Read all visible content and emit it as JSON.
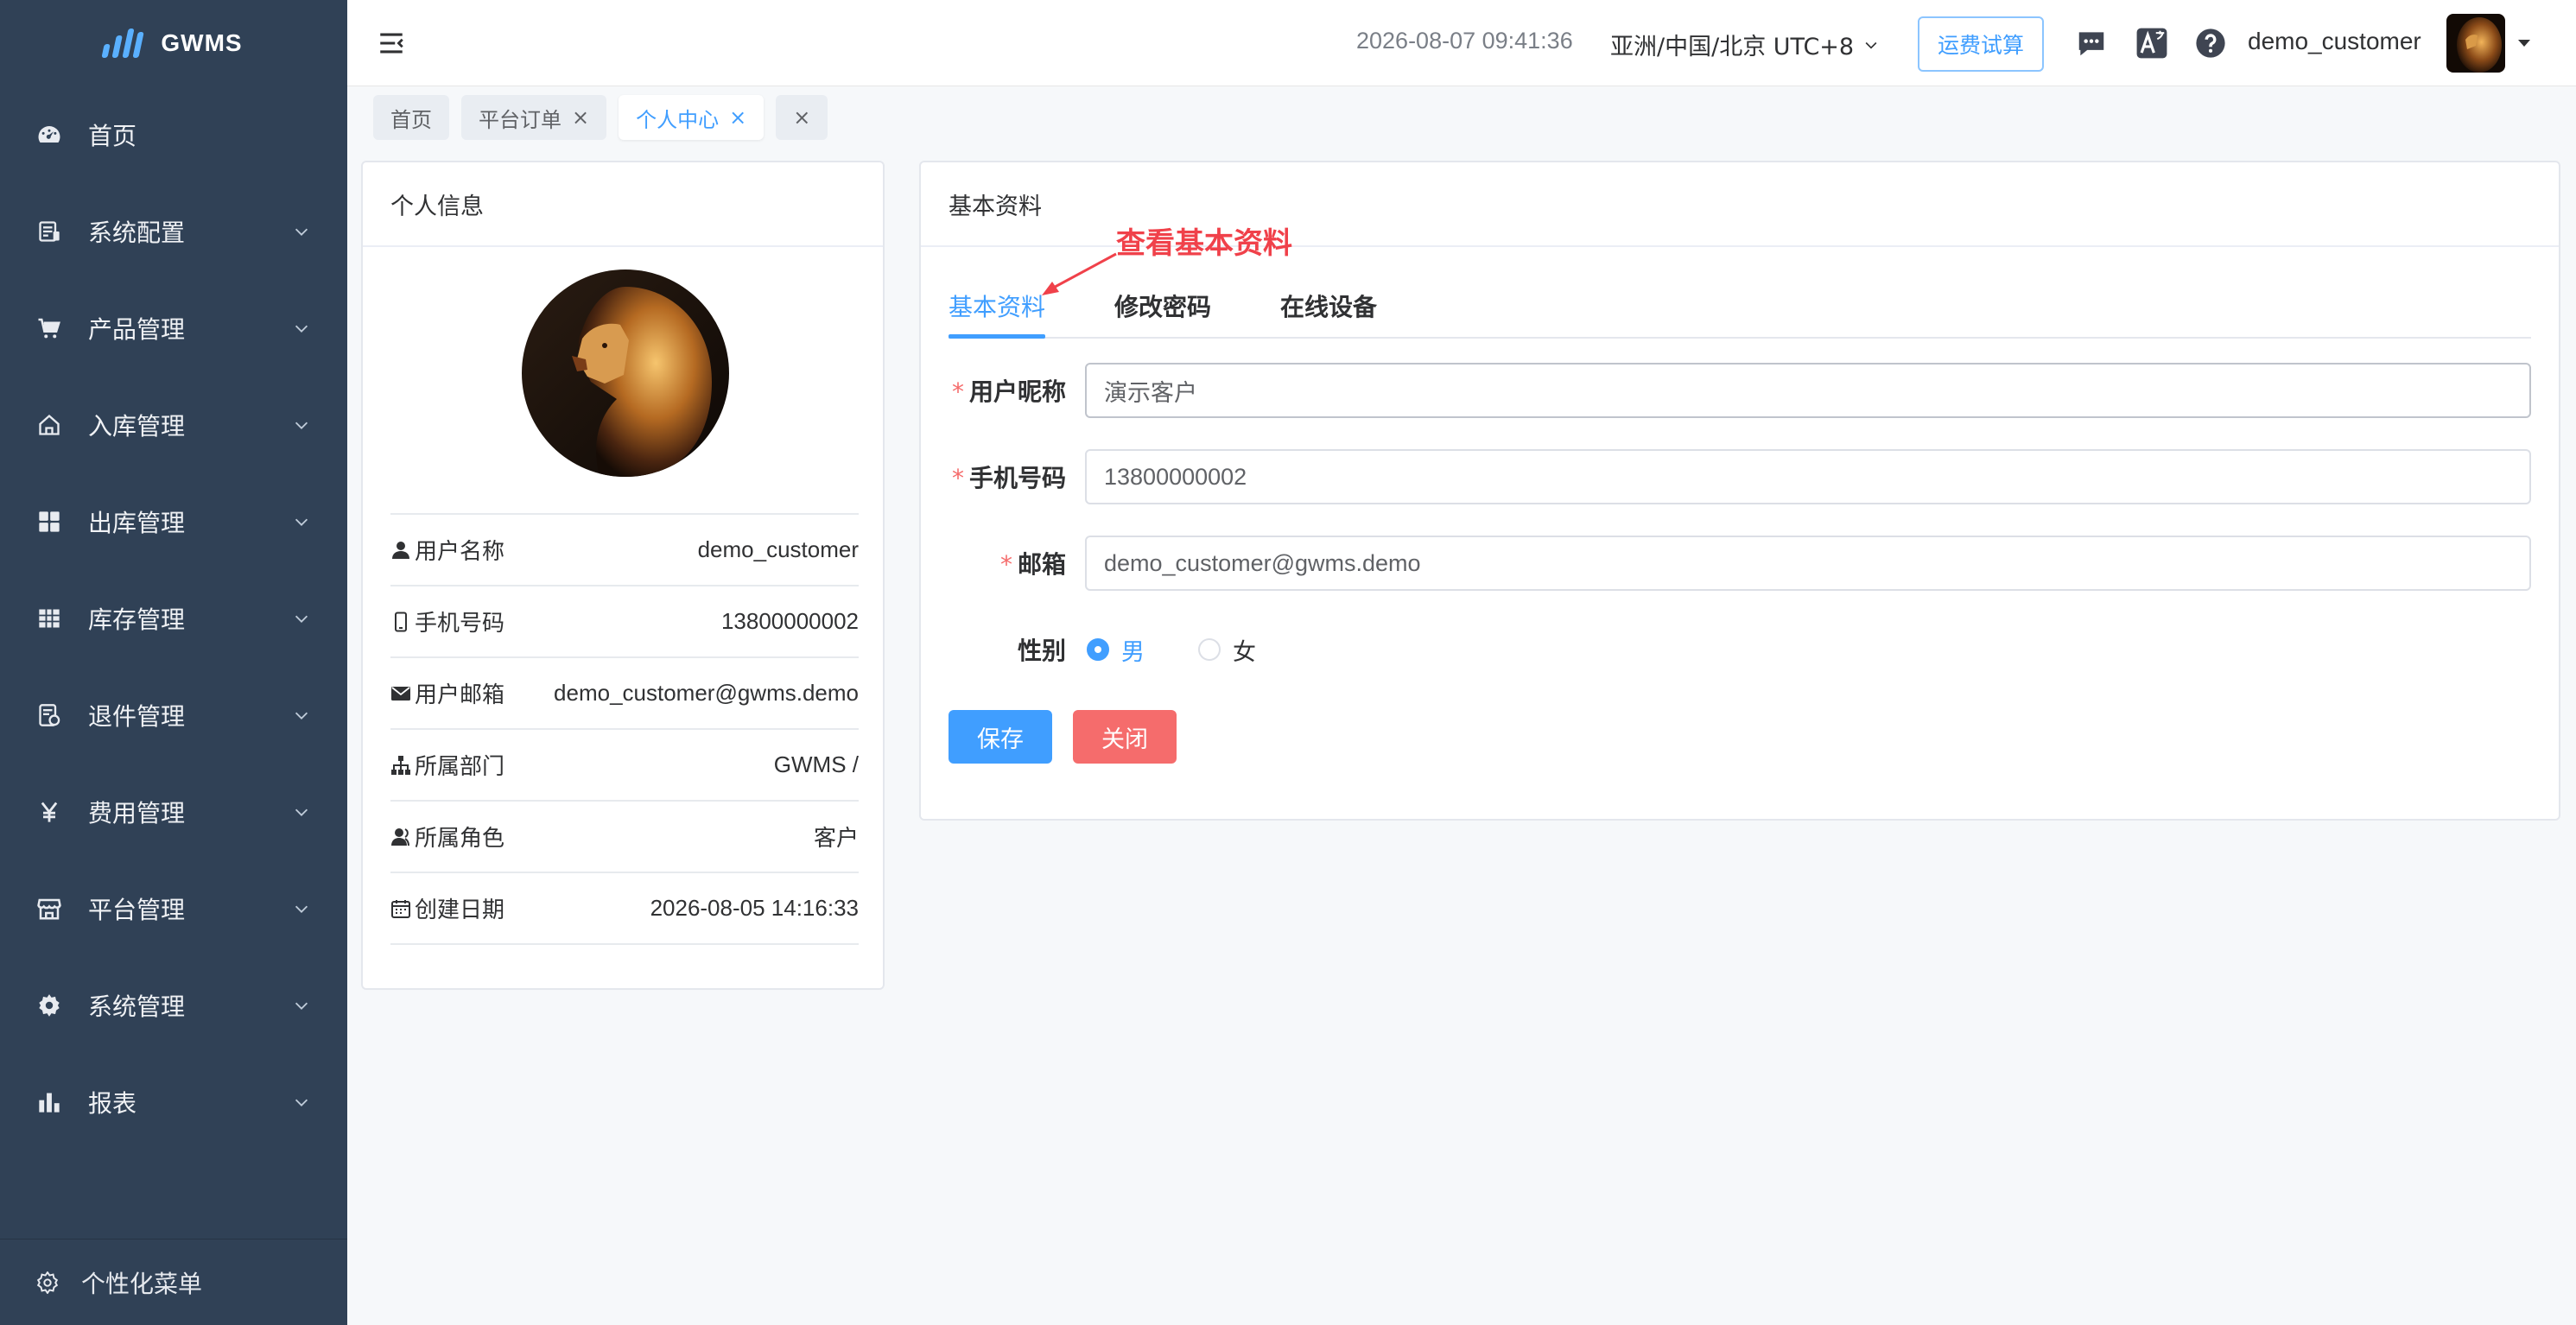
{
  "sidebar": {
    "logo_text": "GWMS",
    "items": [
      {
        "label": "首页",
        "icon": "dashboard-icon",
        "has_arrow": false
      },
      {
        "label": "系统配置",
        "icon": "system-config-icon",
        "has_arrow": true
      },
      {
        "label": "产品管理",
        "icon": "cart-icon",
        "has_arrow": true
      },
      {
        "label": "入库管理",
        "icon": "inbound-home-icon",
        "has_arrow": true
      },
      {
        "label": "出库管理",
        "icon": "grid-icon",
        "has_arrow": true
      },
      {
        "label": "库存管理",
        "icon": "table-icon",
        "has_arrow": true
      },
      {
        "label": "退件管理",
        "icon": "return-doc-icon",
        "has_arrow": true
      },
      {
        "label": "费用管理",
        "icon": "yen-icon",
        "has_arrow": true
      },
      {
        "label": "平台管理",
        "icon": "store-icon",
        "has_arrow": true
      },
      {
        "label": "系统管理",
        "icon": "gear-icon",
        "has_arrow": true
      },
      {
        "label": "报表",
        "icon": "bar-chart-icon",
        "has_arrow": true
      }
    ],
    "footer_label": "个性化菜单"
  },
  "topbar": {
    "datetime": "2026-08-07 09:41:36",
    "timezone": "亚洲/中国/北京 UTC+8",
    "freight_button": "运费试算",
    "username": "demo_customer"
  },
  "tags": [
    {
      "label": "首页",
      "closable": false,
      "active": false
    },
    {
      "label": "平台订单",
      "closable": true,
      "active": false
    },
    {
      "label": "个人中心",
      "closable": true,
      "active": true
    },
    {
      "label": "",
      "closable": true,
      "active": false
    }
  ],
  "profile": {
    "title": "个人信息",
    "rows": [
      {
        "label": "用户名称",
        "value": "demo_customer",
        "icon": "user-icon"
      },
      {
        "label": "手机号码",
        "value": "13800000002",
        "icon": "phone-icon"
      },
      {
        "label": "用户邮箱",
        "value": "demo_customer@gwms.demo",
        "icon": "mail-icon"
      },
      {
        "label": "所属部门",
        "value": "GWMS /",
        "icon": "org-tree-icon"
      },
      {
        "label": "所属角色",
        "value": "客户",
        "icon": "role-icon"
      },
      {
        "label": "创建日期",
        "value": "2026-08-05 14:16:33",
        "icon": "calendar-icon"
      }
    ]
  },
  "basic": {
    "title": "基本资料",
    "annotation": "查看基本资料",
    "tabs": [
      "基本资料",
      "修改密码",
      "在线设备"
    ],
    "active_tab": 0,
    "fields": {
      "nickname": {
        "label": "用户昵称",
        "value": "演示客户",
        "required": true
      },
      "phone": {
        "label": "手机号码",
        "value": "13800000002",
        "required": true
      },
      "email": {
        "label": "邮箱",
        "value": "demo_customer@gwms.demo",
        "required": true
      }
    },
    "gender": {
      "label": "性别",
      "options": [
        "男",
        "女"
      ],
      "selected": "男"
    },
    "save_label": "保存",
    "close_label": "关闭"
  },
  "colors": {
    "sidebar_bg": "#304156",
    "primary": "#409eff",
    "danger": "#f56c6c",
    "annotation": "#f0414a"
  }
}
